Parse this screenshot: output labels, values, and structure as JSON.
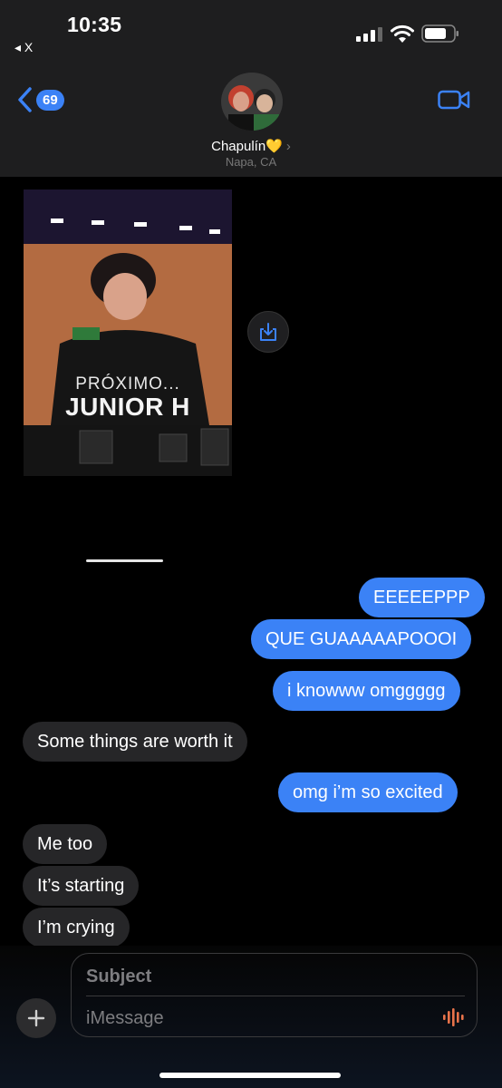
{
  "status": {
    "time": "10:35",
    "back_app": "◂ X"
  },
  "header": {
    "unread_count": "69",
    "contact_name": "Chapulín",
    "contact_heart": "💛",
    "contact_chevron": "›",
    "contact_location": "Napa, CA"
  },
  "photo": {
    "caption_line1": "PRÓXIMO...",
    "caption_line2": "JUNIOR H"
  },
  "messages": [
    {
      "text": "EEEEEPPP",
      "from": "me"
    },
    {
      "text": "QUE GUAAAAAPOOOI",
      "from": "me"
    },
    {
      "text": "i knowww omggggg",
      "from": "me"
    },
    {
      "text": "Some things are worth it",
      "from": "them"
    },
    {
      "text": "omg i’m so excited",
      "from": "me"
    },
    {
      "text": "Me too",
      "from": "them"
    },
    {
      "text": "It’s starting",
      "from": "them"
    },
    {
      "text": "I’m crying",
      "from": "them"
    }
  ],
  "compose": {
    "subject_placeholder": "Subject",
    "message_placeholder": "iMessage",
    "plus_label": "+"
  },
  "colors": {
    "sent_bubble": "#3b82f6",
    "received_bubble": "#262628",
    "accent": "#3b82f6"
  },
  "icons": {
    "back": "chevron-left-icon",
    "video": "video-camera-icon",
    "save": "download-icon",
    "audio": "waveform-icon"
  }
}
